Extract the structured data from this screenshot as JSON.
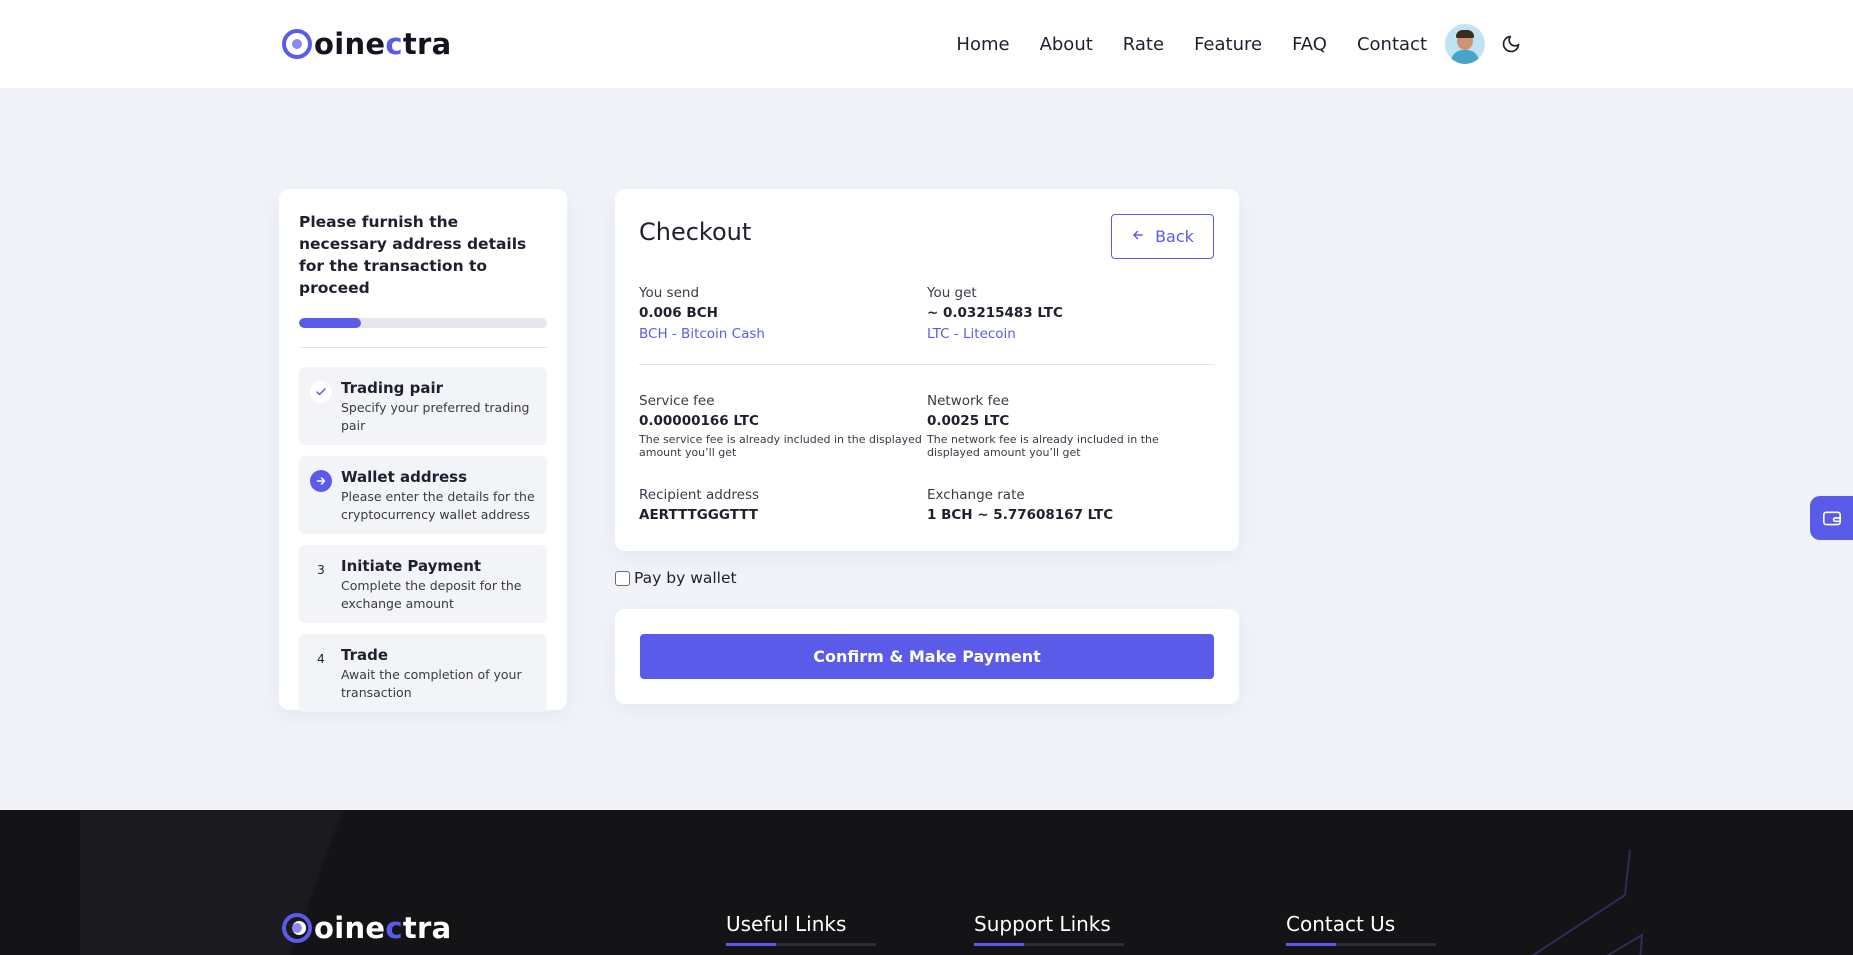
{
  "header": {
    "brand": {
      "prefix": "oine",
      "accent": "c",
      "suffix": "tra"
    },
    "nav": [
      "Home",
      "About",
      "Rate",
      "Feature",
      "FAQ",
      "Contact"
    ],
    "avatar_icon": "user-avatar",
    "theme_icon": "moon-icon"
  },
  "steps_panel": {
    "title": "Please furnish the necessary address details for the transaction to proceed",
    "progress_percent": 25,
    "steps": [
      {
        "marker": "✓",
        "state": "done",
        "name": "Trading pair",
        "desc": "Specify your preferred trading pair"
      },
      {
        "marker": "→",
        "state": "active",
        "name": "Wallet address",
        "desc": "Please enter the details for the cryptocurrency wallet address"
      },
      {
        "marker": "3",
        "state": "pending",
        "name": "Initiate Payment",
        "desc": "Complete the deposit for the exchange amount"
      },
      {
        "marker": "4",
        "state": "pending",
        "name": "Trade",
        "desc": "Await the completion of your transaction"
      }
    ]
  },
  "checkout": {
    "title": "Checkout",
    "back_label": "Back",
    "you_send": {
      "label": "You send",
      "value": "0.006 BCH",
      "currency": "BCH - Bitcoin Cash"
    },
    "you_get": {
      "label": "You get",
      "value": "~ 0.03215483 LTC",
      "currency": "LTC - Litecoin"
    },
    "service_fee": {
      "label": "Service fee",
      "value": "0.00000166 LTC",
      "note": "The service fee is already included in the displayed amount you’ll get"
    },
    "network_fee": {
      "label": "Network fee",
      "value": "0.0025 LTC",
      "note": "The network fee is already included in the displayed amount you’ll get"
    },
    "recipient": {
      "label": "Recipient address",
      "value": "AERTTTGGGTTT"
    },
    "exchange_rate": {
      "label": "Exchange rate",
      "value": "1 BCH ~ 5.77608167 LTC"
    }
  },
  "pay_by_wallet": {
    "label": "Pay by wallet",
    "checked": false
  },
  "confirm_label": "Confirm & Make Payment",
  "footer": {
    "brand": {
      "prefix": "oine",
      "accent": "c",
      "suffix": "tra"
    },
    "columns": [
      "Useful Links",
      "Support Links",
      "Contact Us"
    ]
  },
  "colors": {
    "accent": "#5b5bea",
    "background": "#f1f3f9",
    "footer": "#141417"
  }
}
